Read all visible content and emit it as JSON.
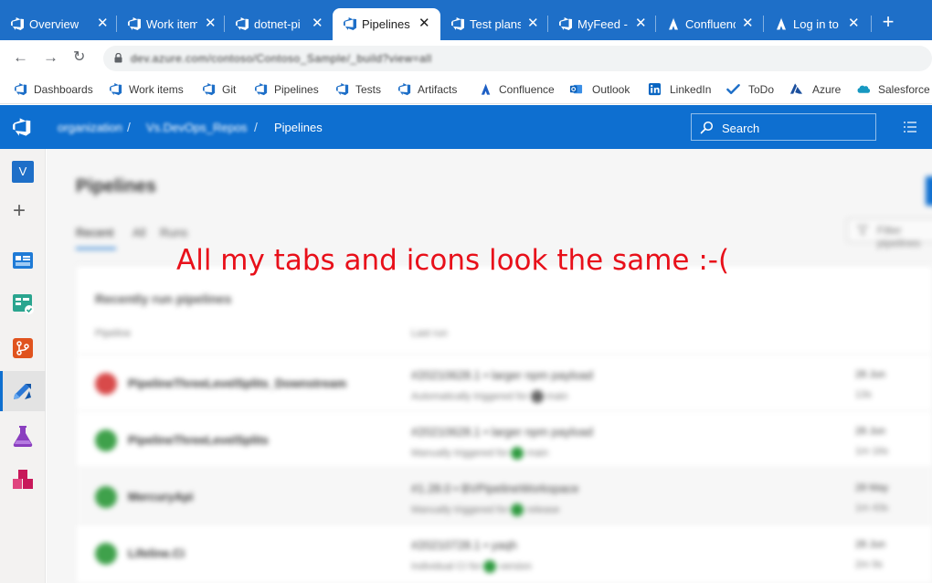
{
  "browser": {
    "tabs": [
      {
        "title": "Overview",
        "icon": "azure-devops-icon",
        "active": false
      },
      {
        "title": "Work item",
        "icon": "azure-devops-icon",
        "active": false
      },
      {
        "title": "dotnet-pi",
        "icon": "azure-devops-icon",
        "active": false
      },
      {
        "title": "Pipelines",
        "icon": "azure-devops-icon",
        "active": true
      },
      {
        "title": "Test plans",
        "icon": "azure-devops-icon",
        "active": false
      },
      {
        "title": "MyFeed -",
        "icon": "azure-devops-icon",
        "active": false
      },
      {
        "title": "Confluence",
        "icon": "confluence-icon",
        "active": false
      },
      {
        "title": "Log in to",
        "icon": "confluence-icon",
        "active": false
      }
    ],
    "new_tab_label": "+",
    "url": "dev.azure.com/contoso/Contoso_Sample/_build?view=all",
    "bookmarks": [
      {
        "label": "Dashboards",
        "icon": "azure-devops-icon"
      },
      {
        "label": "Work items",
        "icon": "azure-devops-icon"
      },
      {
        "label": "Git",
        "icon": "azure-devops-icon"
      },
      {
        "label": "Pipelines",
        "icon": "azure-devops-icon"
      },
      {
        "label": "Tests",
        "icon": "azure-devops-icon"
      },
      {
        "label": "Artifacts",
        "icon": "azure-devops-icon"
      },
      {
        "label": "Confluence",
        "icon": "confluence-icon"
      },
      {
        "label": "Outlook",
        "icon": "outlook-icon"
      },
      {
        "label": "LinkedIn",
        "icon": "linkedin-icon"
      },
      {
        "label": "ToDo",
        "icon": "todo-check-icon"
      },
      {
        "label": "Azure",
        "icon": "azure-icon"
      },
      {
        "label": "Salesforce",
        "icon": "salesforce-icon"
      }
    ]
  },
  "header": {
    "org": "organization",
    "project": "Vs.DevOps_Repos",
    "page": "Pipelines",
    "search_placeholder": "Search"
  },
  "sidebar": {
    "project_initial": "V",
    "add_label": "+"
  },
  "main": {
    "title": "Pipelines",
    "pivots": [
      "Recent",
      "All",
      "Runs"
    ],
    "filter_placeholder": "Filter pipelines",
    "card_title": "Recently run pipelines",
    "columns": [
      "Pipeline",
      "Last run"
    ],
    "rows": [
      {
        "name": "PipelineThreeLevelSplits_Downstream",
        "run": "#20210628.1 • larger npm payload",
        "sub": "Automatically triggered for",
        "sub_tail": "main",
        "time": "28 Jun",
        "duration": "13s",
        "status": "failed"
      },
      {
        "name": "PipelineThreeLevelSplits",
        "run": "#20210628.1 • larger npm payload",
        "sub": "Manually triggered for",
        "sub_tail": "main",
        "time": "28 Jun",
        "duration": "1m 16s",
        "status": "succeeded"
      },
      {
        "name": "MercuryApi",
        "run": "#1.28.0 • BVPipelineWorkspace",
        "sub": "Manually triggered for",
        "sub_tail": "release",
        "time": "28 May",
        "duration": "1m 43s",
        "status": "succeeded"
      },
      {
        "name": "Lifeline.Ci",
        "run": "#20210728.1 • yaqh",
        "sub": "Individual CI for",
        "sub_tail": "version",
        "time": "28 Jun",
        "duration": "2m 9s",
        "status": "succeeded"
      }
    ]
  },
  "annotation": "All my tabs and icons look the same :-(",
  "colors": {
    "tabbar": "#1e6fc8",
    "ado_blue": "#0e6fd0",
    "annotation_red": "#e8101a",
    "failed": "#d84a4a",
    "succeeded": "#3fa14b"
  }
}
